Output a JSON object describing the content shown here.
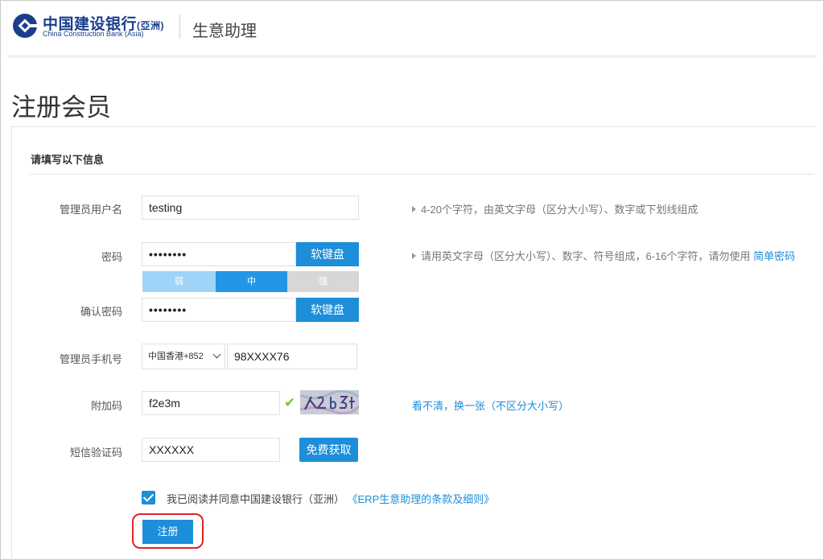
{
  "header": {
    "bank_name_cn": "中国建设银行",
    "bank_name_region": "(亞洲)",
    "bank_name_en": "China Construction Bank (Asia)",
    "app_title": "生意助理"
  },
  "page_title": "注册会员",
  "form": {
    "section_title": "请填写以下信息",
    "username": {
      "label": "管理员用户名",
      "value": "testing",
      "hint": "4-20个字符，由英文字母（区分大小写）、数字或下划线组成"
    },
    "password": {
      "label": "密码",
      "value": "••••••••",
      "keyboard_button": "软键盘",
      "hint": "请用英文字母（区分大小写）、数字、符号组成，6-16个字符，请勿使用",
      "hint_link": "简单密码",
      "strength": {
        "weak": "弱",
        "medium": "中",
        "strong": "强",
        "level": "medium"
      }
    },
    "confirm_password": {
      "label": "确认密码",
      "value": "••••••••",
      "keyboard_button": "软键盘"
    },
    "phone": {
      "label": "管理员手机号",
      "country_code": "中国香港+852",
      "value": "98XXXX76"
    },
    "captcha": {
      "label": "附加码",
      "value": "f2e3m",
      "image_text": "XZbJE",
      "refresh_link": "看不清，换一张（不区分大小写）"
    },
    "sms_code": {
      "label": "短信验证码",
      "value": "XXXXXX",
      "get_button": "免费获取"
    },
    "agreement": {
      "checked": true,
      "text": "我已阅读并同意中国建设银行（亚洲）",
      "link": "《ERP生意助理的条款及细则》"
    },
    "submit_button": "注册"
  },
  "colors": {
    "accent": "#1d8ed9",
    "strength_weak": "#9fd3f7",
    "strength_medium": "#2596e6",
    "strength_strong": "#d7d7d7",
    "highlight": "#e02424",
    "success": "#7ac142"
  }
}
